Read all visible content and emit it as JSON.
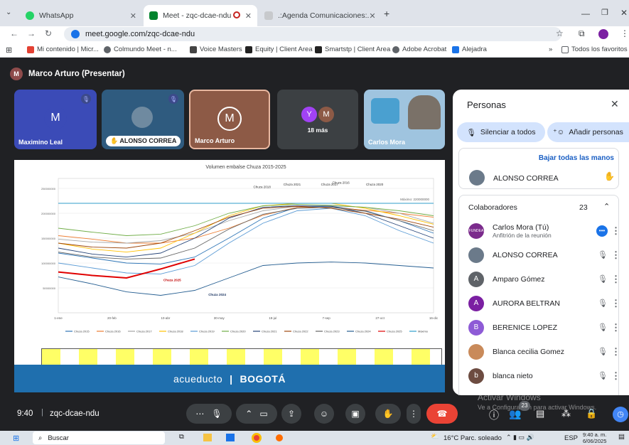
{
  "browser": {
    "tabs": [
      {
        "label": "WhatsApp",
        "active": false,
        "color": "#25d366"
      },
      {
        "label": "Meet - zqc-dcae-ndu",
        "active": true,
        "color": "#00832d"
      },
      {
        "label": ".:Agenda Comunicaciones:.",
        "active": false,
        "color": "#c7c9cc"
      }
    ],
    "new_tab": "+",
    "url": "meet.google.com/zqc-dcae-ndu",
    "bookmarks": [
      "Mi contenido | Micr...",
      "Colmundo Meet - n...",
      "Voice Masters",
      "Equity | Client Area",
      "Smartstp | Client Area",
      "Adobe Acrobat",
      "Alejadra"
    ],
    "bookmarks_more": "»",
    "bookmarks_folder": "Todos los favoritos"
  },
  "meet": {
    "presenter": "Marco Arturo (Presentar)",
    "presenter_initial": "M",
    "tiles": [
      {
        "name": "Maximino Leal",
        "initial": "M"
      },
      {
        "name": "ALONSO CORREA"
      },
      {
        "name": "Marco Arturo",
        "initial": "M"
      },
      {
        "initials": [
          "Y",
          "M"
        ],
        "more": "18 más"
      },
      {
        "name": "Carlos Mora"
      }
    ],
    "meeting_time": "9:40",
    "meeting_code": "zqc-dcae-ndu",
    "participant_count": "23"
  },
  "slide": {
    "banner_left": "acueducto",
    "banner_right": "BOGOTÁ"
  },
  "chart_data": {
    "type": "line",
    "title": "Volumen embalse Chuza 2015-2025",
    "x": [
      "1-ene",
      "20-feb",
      "10-abr",
      "30-may",
      "19-jul",
      "7-sep",
      "27-oct",
      "16-dic"
    ],
    "y_ticks": [
      "250000000",
      "200000000",
      "150000000",
      "100000000",
      "50000000"
    ],
    "ylim": [
      0,
      270000000
    ],
    "max_label": "Máximo: 220000000",
    "max_value": 220000000,
    "annotations": [
      "Chuza 2025",
      "Chuza 2024",
      "Chuza 2018",
      "Chuza 2021",
      "Chuza 2017",
      "Chuza 2016",
      "Chuza 2020"
    ],
    "series": [
      {
        "name": "Chuza 2015",
        "color": "#2e75b6",
        "values": [
          120,
          110,
          100,
          98,
          112,
          150,
          190,
          212,
          214,
          205,
          185,
          160
        ]
      },
      {
        "name": "Chuza 2016",
        "color": "#ed7d31",
        "values": [
          155,
          148,
          140,
          140,
          150,
          170,
          196,
          212,
          212,
          206,
          200,
          192
        ]
      },
      {
        "name": "Chuza 2017",
        "color": "#a5a5a5",
        "values": [
          148,
          142,
          140,
          145,
          160,
          185,
          205,
          214,
          215,
          212,
          200,
          180
        ]
      },
      {
        "name": "Chuza 2018",
        "color": "#ffc000",
        "values": [
          140,
          128,
          122,
          130,
          160,
          195,
          215,
          220,
          220,
          210,
          195,
          178
        ]
      },
      {
        "name": "Chuza 2019",
        "color": "#5b9bd5",
        "values": [
          100,
          90,
          80,
          78,
          95,
          140,
          180,
          205,
          210,
          195,
          165,
          140
        ]
      },
      {
        "name": "Chuza 2020",
        "color": "#70ad47",
        "values": [
          170,
          162,
          155,
          158,
          175,
          200,
          215,
          218,
          216,
          212,
          205,
          195
        ]
      },
      {
        "name": "Chuza 2021",
        "color": "#264478",
        "values": [
          130,
          118,
          112,
          120,
          150,
          190,
          212,
          215,
          214,
          200,
          175,
          150
        ]
      },
      {
        "name": "Chuza 2022",
        "color": "#9e480e",
        "values": [
          140,
          132,
          130,
          140,
          165,
          192,
          210,
          214,
          210,
          200,
          188,
          172
        ]
      },
      {
        "name": "Chuza 2023",
        "color": "#636363",
        "values": [
          122,
          112,
          108,
          110,
          130,
          168,
          198,
          210,
          212,
          204,
          185,
          165
        ]
      },
      {
        "name": "Chuza 2024",
        "color": "#255e91",
        "values": [
          72,
          58,
          42,
          35,
          45,
          70,
          95,
          100,
          102,
          100,
          95,
          90
        ]
      },
      {
        "name": "Chuza 2025",
        "color": "#e00000",
        "values": [
          82,
          75,
          70,
          88,
          108
        ]
      },
      {
        "name": "Máximo",
        "color": "#2f9ecb",
        "values": [
          220,
          220,
          220,
          220,
          220,
          220,
          220,
          220,
          220,
          220,
          220,
          220
        ]
      }
    ]
  },
  "panel": {
    "title": "Personas",
    "mute_all": "Silenciar a todos",
    "add_people": "Añadir personas",
    "lower_hands": "Bajar todas las manos",
    "raised": {
      "name": "ALONSO CORREA"
    },
    "section": "Colaboradores",
    "section_count": "23",
    "people": [
      {
        "name": "Carlos Mora (Tú)",
        "sub": "Anfitrión de la reunión",
        "color": "#7b2b8c",
        "initial": "FUNDEA"
      },
      {
        "name": "ALONSO CORREA",
        "color": "#6b7a8a",
        "initial": ""
      },
      {
        "name": "Amparo Gómez",
        "color": "#5f6368",
        "initial": "A"
      },
      {
        "name": "AURORA BELTRAN",
        "color": "#7b1fa2",
        "initial": "A"
      },
      {
        "name": "BERENICE LOPEZ",
        "color": "#8e5bd6",
        "initial": "B"
      },
      {
        "name": "Blanca cecilia Gomez",
        "color": "#c98a5a",
        "initial": ""
      },
      {
        "name": "blanca nieto",
        "color": "#6d4c41",
        "initial": "b"
      }
    ]
  },
  "watermark": {
    "line1": "Activar Windows",
    "line2": "Ve a Configuración para activar Windows."
  },
  "taskbar": {
    "search": "Buscar",
    "weather": "16°C Parc. soleado",
    "lang": "ESP",
    "time": "9:40 a. m.",
    "date": "6/06/2025"
  }
}
